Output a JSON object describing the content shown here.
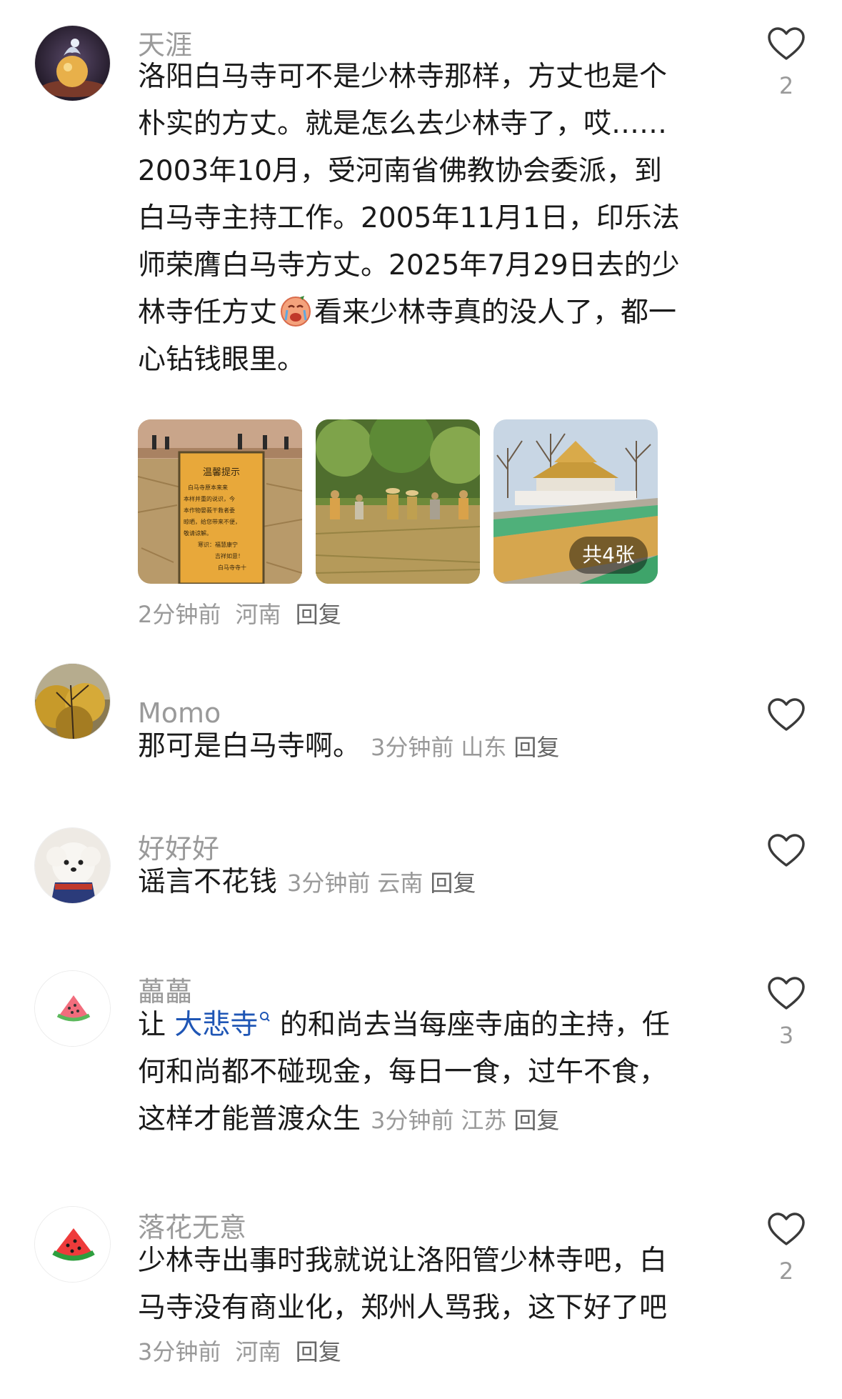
{
  "comments": [
    {
      "username": "天涯",
      "content_lines": [
        "洛阳白马寺可不是少林寺那样，方丈也是个",
        "朴实的方丈。就是怎么去少林寺了，哎……",
        "2003年10月，受河南省佛教协会委派，到",
        "白马寺主持工作。2005年11月1日，印乐法",
        "师荣膺白马寺方丈。2025年7月29日去的少"
      ],
      "line6_before": "林寺任方丈",
      "line6_after": "看来少林寺真的没人了，都一",
      "line7": "心钻钱眼里。",
      "emoji": "crying-face-emoji",
      "images": {
        "sign_title": "温馨提示",
        "sign_lines": [
          "白马寺原本来来",
          "本样并重的说识，今",
          "本作物晏莪干救者委",
          "晾晒，给您带来不便，",
          "敬请谅解。",
          "寒识：福慧康宁",
          "吉祥如意！",
          "白马寺寺十"
        ],
        "count_badge": "共4张"
      },
      "time": "2分钟前",
      "location": "河南",
      "reply": "回复",
      "likes": "2"
    },
    {
      "username": "Momo",
      "content": "那可是白马寺啊。",
      "time": "3分钟前",
      "location": "山东",
      "reply": "回复",
      "likes": ""
    },
    {
      "username": "好好好",
      "content": "谣言不花钱",
      "time": "3分钟前",
      "location": "云南",
      "reply": "回复",
      "likes": ""
    },
    {
      "username": "藟藟",
      "line1_prefix": "让 ",
      "link_text": "大悲寺",
      "line1_suffix": " 的和尚去当每座寺庙的主持，任",
      "line2": "何和尚都不碰现金，每日一食，过午不食，",
      "line3": "这样才能普渡众生",
      "time": "3分钟前",
      "location": "江苏",
      "reply": "回复",
      "likes": "3"
    },
    {
      "username": "落花无意",
      "line1": "少林寺出事时我就说让洛阳管少林寺吧，白",
      "line2": "马寺没有商业化，郑州人骂我，这下好了吧",
      "time": "3分钟前",
      "location": "河南",
      "reply": "回复",
      "likes": "2"
    }
  ],
  "icons": {
    "like": "heart-outline-icon",
    "search_hint": "search-icon"
  },
  "colors": {
    "text": "#1a1a1a",
    "username": "#9a9a9a",
    "meta": "#999999",
    "link": "#1f56b5",
    "heart": "#3a3a3a"
  }
}
